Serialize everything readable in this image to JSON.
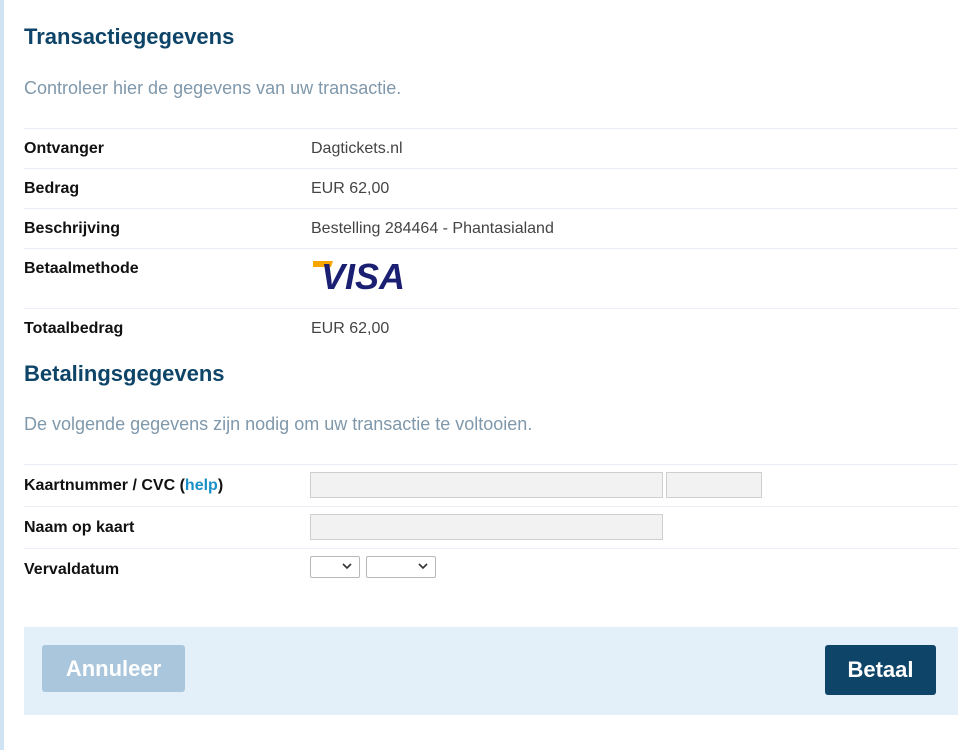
{
  "transaction": {
    "title": "Transactiegegevens",
    "intro": "Controleer hier de gegevens van uw transactie.",
    "rows": [
      {
        "label": "Ontvanger",
        "value": "Dagtickets.nl"
      },
      {
        "label": "Bedrag",
        "value": "EUR 62,00"
      },
      {
        "label": "Beschrijving",
        "value": "Bestelling 284464 - Phantasialand"
      },
      {
        "label": "Betaalmethode",
        "value": "VISA"
      },
      {
        "label": "Totaalbedrag",
        "value": "EUR 62,00"
      }
    ]
  },
  "payment": {
    "title": "Betalingsgegevens",
    "intro": "De volgende gegevens zijn nodig om uw transactie te voltooien.",
    "card_label": "Kaartnummer / CVC (",
    "help_label": "help",
    "card_label_suffix": ")",
    "name_label": "Naam op kaart",
    "expiry_label": "Vervaldatum",
    "card_number_value": "",
    "cvc_value": "",
    "name_value": "",
    "month_value": "",
    "year_value": ""
  },
  "buttons": {
    "cancel_label": "Annuleer",
    "pay_label": "Betaal"
  },
  "colors": {
    "brand": "#0e4468",
    "muted": "#7f98ab",
    "link": "#1a90c8",
    "footer_bg": "#e3eff9",
    "cancel_bg": "#a9c6dc",
    "visa_blue": "#1a1f71",
    "visa_gold": "#f7a600"
  },
  "icons": {
    "dropdown": "chevron-down-icon",
    "payment_logo": "visa-logo"
  }
}
